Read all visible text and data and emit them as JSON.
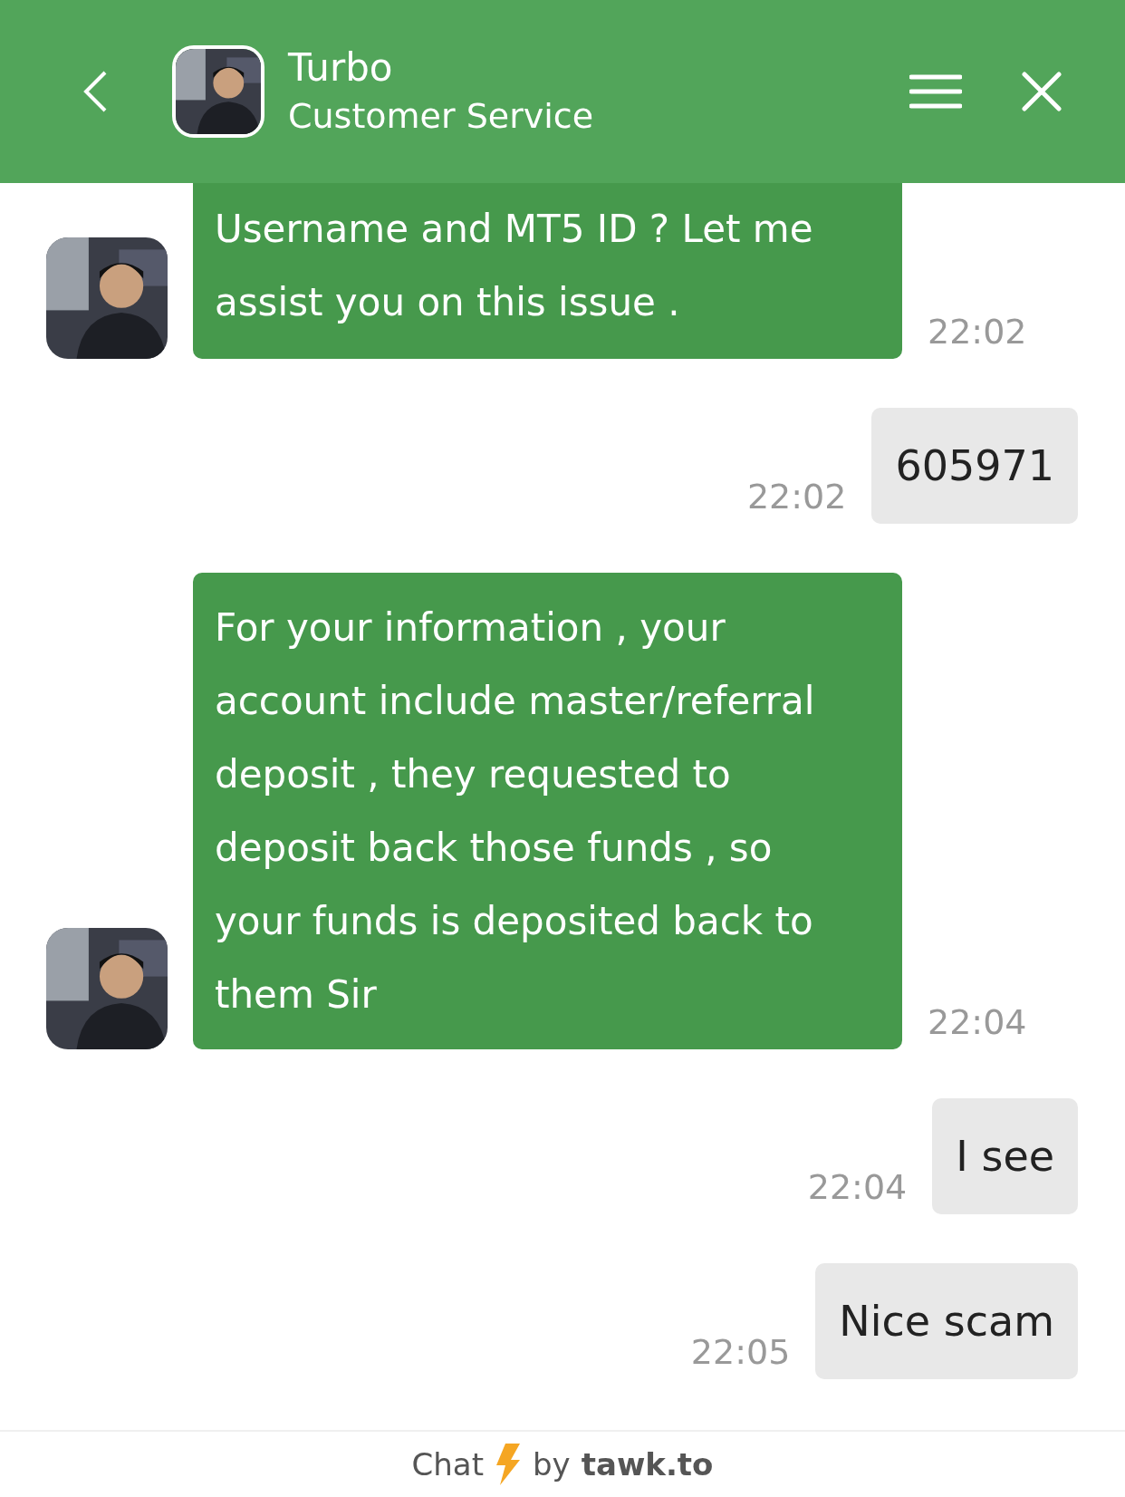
{
  "header": {
    "title": "Turbo",
    "subtitle": "Customer Service"
  },
  "messages": [
    {
      "kind": "agent",
      "text": "Username and MT5 ID ? Let me\nassist you on this issue .",
      "time": "22:02",
      "cut": true
    },
    {
      "kind": "user",
      "text": "605971",
      "time": "22:02"
    },
    {
      "kind": "agent",
      "text": "For your information , your\naccount include master/referral\ndeposit , they requested to\ndeposit back those funds , so\nyour funds is deposited back to\nthem Sir",
      "time": "22:04"
    },
    {
      "kind": "user",
      "text": "I see",
      "time": "22:04"
    },
    {
      "kind": "user",
      "text": "Nice scam",
      "time": "22:05"
    }
  ],
  "footer": {
    "chat": "Chat",
    "by": "by",
    "brand": "tawk.to"
  }
}
